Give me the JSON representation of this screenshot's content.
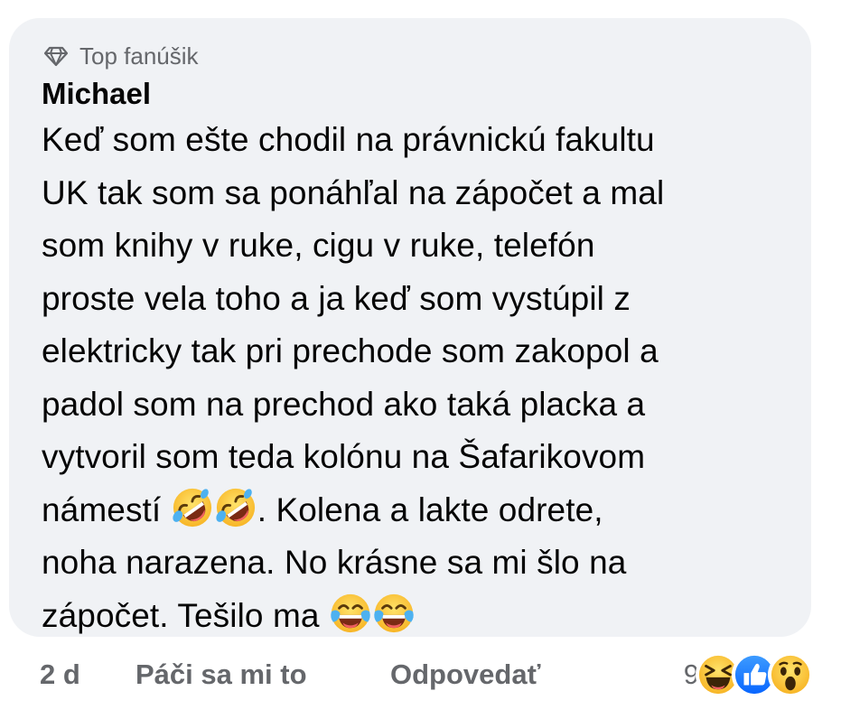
{
  "comment": {
    "badge": {
      "icon": "diamond-icon",
      "label": "Top fanúšik"
    },
    "author": "Michael",
    "lines": [
      "Keď som ešte chodil na právnickú fakultu",
      "UK tak som sa ponáhľal na zápočet a mal",
      "som knihy v ruke, cigu v ruke, telefón",
      "proste vela toho a ja keď som vystúpil z",
      "elektricky tak pri prechode som zakopol a",
      "padol som na prechod ako taká placka a",
      "vytvoril som teda kolónu na Šafarikovom"
    ],
    "line8_text": "námestí",
    "line8_after": ". Kolena a lakte odrete,",
    "line9": "noha narazena. No krásne sa mi šlo na",
    "line10_text": "zápočet. Tešilo ma",
    "emojis": {
      "line8": [
        "rolling-on-floor-laughing-emoji",
        "rolling-on-floor-laughing-emoji"
      ],
      "line10": [
        "tears-of-joy-emoji",
        "tears-of-joy-emoji"
      ]
    }
  },
  "actions": {
    "time": "2 d",
    "like": "Páči sa mi to",
    "reply": "Odpovedať"
  },
  "reactions": {
    "count": "9",
    "types": [
      "haha-reaction-icon",
      "like-reaction-icon",
      "wow-reaction-icon"
    ]
  },
  "colors": {
    "bubble": "#f0f2f5",
    "text": "#050505",
    "secondary": "#65676b",
    "like_blue": "#1877f2",
    "emoji_yellow": "#fcc936"
  }
}
